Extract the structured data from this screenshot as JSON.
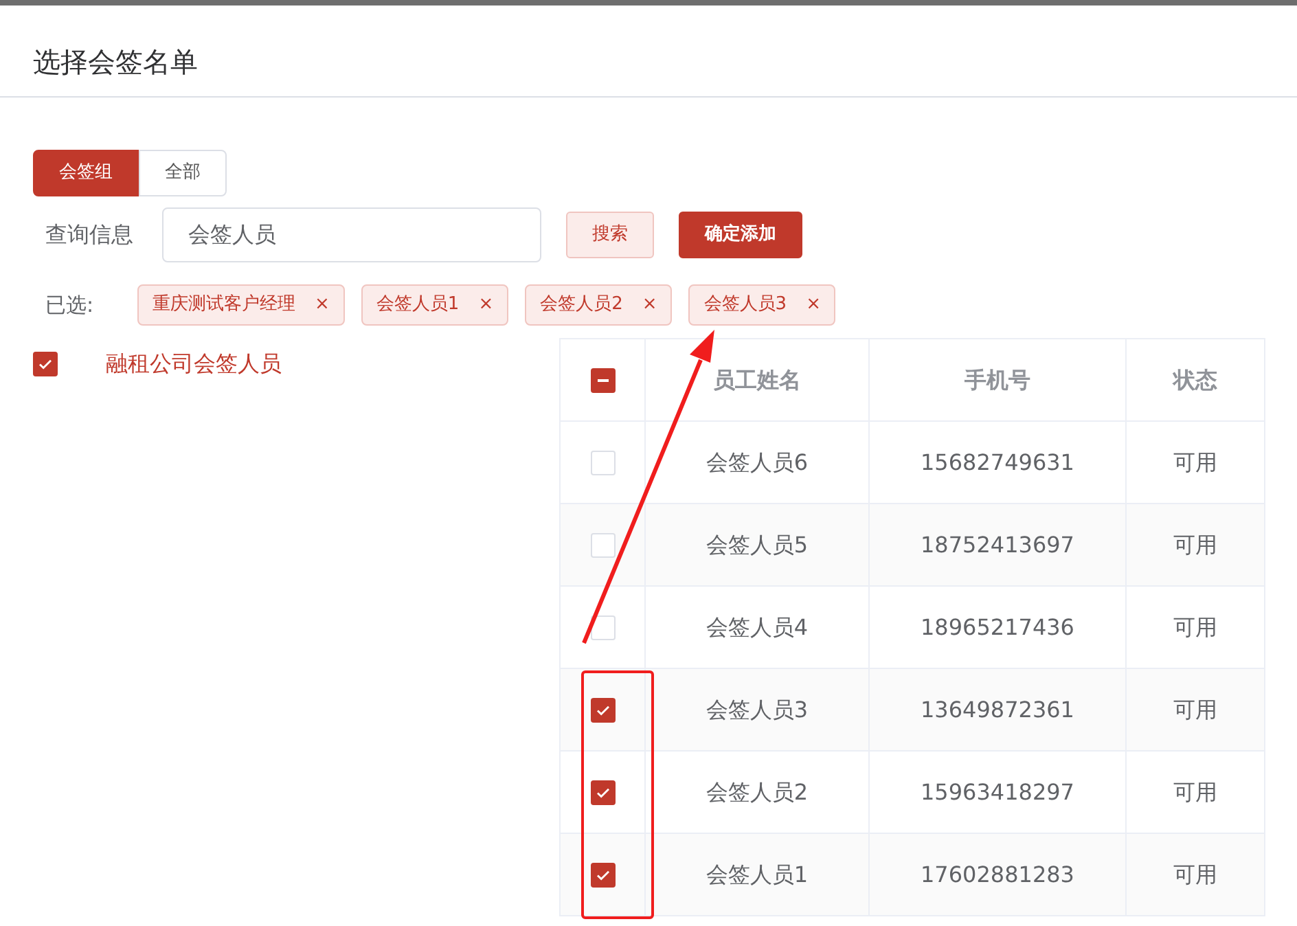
{
  "dialog": {
    "title": "选择会签名单"
  },
  "tabs": [
    {
      "label": "会签组",
      "selected": true
    },
    {
      "label": "全部",
      "selected": false
    }
  ],
  "search": {
    "label": "查询信息",
    "value": "会签人员",
    "search_button": "搜索",
    "confirm_button": "确定添加"
  },
  "selected_tags": {
    "label": "已选:",
    "tags": [
      {
        "text": "重庆测试客户经理",
        "close": "×"
      },
      {
        "text": "会签人员1",
        "close": "×"
      },
      {
        "text": "会签人员2",
        "close": "×"
      },
      {
        "text": "会签人员3",
        "close": "×"
      }
    ]
  },
  "groups": [
    {
      "label": "融租公司会签人员",
      "checked": true
    }
  ],
  "table": {
    "header_checkbox": {
      "indeterminate": true
    },
    "columns": [
      "员工姓名",
      "手机号",
      "状态"
    ],
    "rows": [
      {
        "checked": false,
        "cells": [
          "会签人员6",
          "15682749631",
          "可用"
        ]
      },
      {
        "checked": false,
        "cells": [
          "会签人员5",
          "18752413697",
          "可用"
        ]
      },
      {
        "checked": false,
        "cells": [
          "会签人员4",
          "18965217436",
          "可用"
        ]
      },
      {
        "checked": true,
        "cells": [
          "会签人员3",
          "13649872361",
          "可用"
        ]
      },
      {
        "checked": true,
        "cells": [
          "会签人员2",
          "15963418297",
          "可用"
        ]
      },
      {
        "checked": true,
        "cells": [
          "会签人员1",
          "17602881283",
          "可用"
        ]
      }
    ]
  }
}
